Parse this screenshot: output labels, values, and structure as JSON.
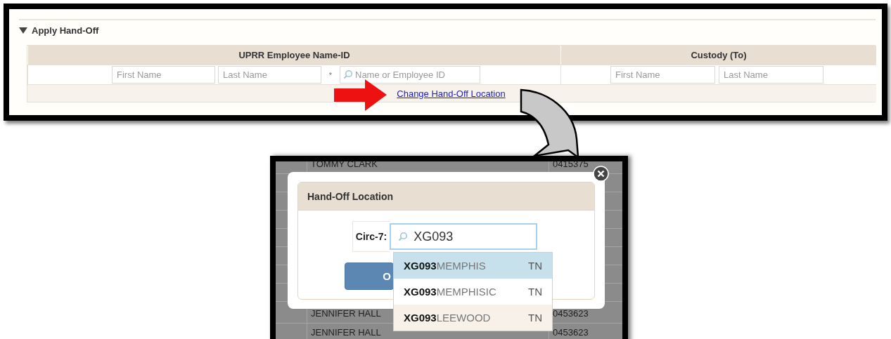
{
  "hand_off_section": {
    "title": "Apply Hand-Off",
    "expanded": true,
    "groups": [
      {
        "label": "UPRR Employee Name-ID",
        "fields": [
          {
            "kind": "text",
            "placeholder": "First Name"
          },
          {
            "kind": "text",
            "placeholder": "Last Name"
          },
          {
            "kind": "mark",
            "text": "*"
          },
          {
            "kind": "search",
            "placeholder": "Name or Employee ID"
          }
        ]
      },
      {
        "label": "Custody (To)",
        "fields": [
          {
            "kind": "text",
            "placeholder": "First Name"
          },
          {
            "kind": "text",
            "placeholder": "Last Name"
          }
        ]
      }
    ],
    "link": "Change Hand-Off Location"
  },
  "background_rows": [
    {
      "name": "TOMMY CLARK",
      "id": "0415375"
    },
    {
      "name": "JENNIFER HALL",
      "id": "0453623"
    },
    {
      "name": "JENNIFER HALL",
      "id": "0453623"
    }
  ],
  "dialog": {
    "title": "Hand-Off Location",
    "field_label": "Circ-7:",
    "search_value": "XG093",
    "button": "O",
    "suggestions": [
      {
        "code": "XG093",
        "name": "MEMPHIS",
        "state": "TN",
        "selected": true
      },
      {
        "code": "XG093",
        "name": "MEMPHISIC",
        "state": "TN",
        "selected": false
      },
      {
        "code": "XG093",
        "name": "LEEWOOD",
        "state": "TN",
        "selected": false
      }
    ]
  }
}
